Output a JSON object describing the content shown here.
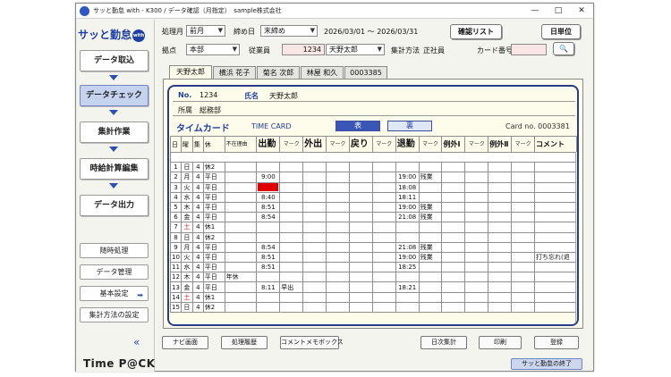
{
  "window": {
    "title": "サッと勤怠 with - K300 / データ確認（月指定）　sample株式会社",
    "controls": [
      "—",
      "□",
      "✕"
    ]
  },
  "sidebar": {
    "logo": "サッと勤怠",
    "logo_badge": "with",
    "steps": [
      "データ取込",
      "データチェック",
      "集計作業",
      "時給計算編集",
      "データ出力"
    ],
    "active_step": "データチェック",
    "buttons": [
      "随時処理",
      "データ管理",
      "基本設定",
      "集計方法の設定"
    ],
    "collapse": "«",
    "brand": "Time P@CK"
  },
  "header": {
    "period_type_label": "処理月",
    "period_type_value": "前月",
    "closing_label": "締め日",
    "closing_value": "末締め",
    "date_range": "2026/03/01 〜 2026/03/31",
    "confirm_list_btn": "確認リスト",
    "daily_btn": "日単位",
    "site_label": "拠点",
    "site_value": "本部",
    "employee_label": "従業員",
    "employee_code": "1234",
    "employee_name": "天野太郎",
    "calc_method_label": "集計方法",
    "calc_method_value": "正社員",
    "card_no_label": "カード番号",
    "card_no_value": "",
    "search_icon": "search-icon"
  },
  "tabs": [
    "天野太郎",
    "横浜 花子",
    "菊名 次郎",
    "林屋 和久",
    "0003385"
  ],
  "active_tab": "天野太郎",
  "employee_info": {
    "no_label": "No.",
    "no_value": "1234",
    "name_label": "氏名",
    "name_value": "天野太郎",
    "dept_label": "所属",
    "dept_value": "総務部"
  },
  "card": {
    "title": "タイムカード",
    "title_en": "TIME CARD",
    "front": "表",
    "back": "裏",
    "card_no": "Card no. 0003381"
  },
  "table": {
    "headers": {
      "day": "日",
      "dow": "曜",
      "agg": "集",
      "rest": "休",
      "absence": "不在理由",
      "in": "出勤",
      "mark": "マーク",
      "out": "外出",
      "back": "戻り",
      "leave": "退勤",
      "ex1": "例外Ⅰ",
      "ex2": "例外Ⅱ",
      "comment": "コメント"
    },
    "rows": [
      {
        "day": "1",
        "dow": "日",
        "agg": "4",
        "rest": "休2",
        "absence": "",
        "in": "",
        "in_mark": "",
        "leave": "",
        "leave_mark": "",
        "comment": ""
      },
      {
        "day": "2",
        "dow": "月",
        "agg": "4",
        "rest": "平日",
        "absence": "",
        "in": "9:00",
        "in_mark": "",
        "leave": "19:00",
        "leave_mark": "残業",
        "comment": ""
      },
      {
        "day": "3",
        "dow": "火",
        "agg": "4",
        "rest": "平日",
        "absence": "",
        "in": "",
        "in_mark": "",
        "leave": "18:08",
        "leave_mark": "",
        "comment": "",
        "missing_in": true
      },
      {
        "day": "4",
        "dow": "水",
        "agg": "4",
        "rest": "平日",
        "absence": "",
        "in": "8:40",
        "in_mark": "",
        "leave": "18:11",
        "leave_mark": "",
        "comment": ""
      },
      {
        "day": "5",
        "dow": "木",
        "agg": "4",
        "rest": "平日",
        "absence": "",
        "in": "8:51",
        "in_mark": "",
        "leave": "19:00",
        "leave_mark": "残業",
        "comment": ""
      },
      {
        "day": "6",
        "dow": "金",
        "agg": "4",
        "rest": "平日",
        "absence": "",
        "in": "8:54",
        "in_mark": "",
        "leave": "21:08",
        "leave_mark": "残業",
        "comment": ""
      },
      {
        "day": "7",
        "dow": "土",
        "agg": "4",
        "rest": "休1",
        "absence": "",
        "in": "",
        "in_mark": "",
        "leave": "",
        "leave_mark": "",
        "comment": "",
        "red_dow": true
      },
      {
        "day": "8",
        "dow": "日",
        "agg": "4",
        "rest": "休2",
        "absence": "",
        "in": "",
        "in_mark": "",
        "leave": "",
        "leave_mark": "",
        "comment": ""
      },
      {
        "day": "9",
        "dow": "月",
        "agg": "4",
        "rest": "平日",
        "absence": "",
        "in": "8:54",
        "in_mark": "",
        "leave": "21:08",
        "leave_mark": "残業",
        "comment": ""
      },
      {
        "day": "10",
        "dow": "火",
        "agg": "4",
        "rest": "平日",
        "absence": "",
        "in": "8:51",
        "in_mark": "",
        "leave": "19:00",
        "leave_mark": "残業",
        "comment": "打ち忘れ(退"
      },
      {
        "day": "11",
        "dow": "水",
        "agg": "4",
        "rest": "平日",
        "absence": "",
        "in": "8:51",
        "in_mark": "",
        "leave": "18:25",
        "leave_mark": "",
        "comment": ""
      },
      {
        "day": "12",
        "dow": "木",
        "agg": "4",
        "rest": "平日",
        "absence": "年休",
        "in": "",
        "in_mark": "",
        "leave": "",
        "leave_mark": "",
        "comment": ""
      },
      {
        "day": "13",
        "dow": "金",
        "agg": "4",
        "rest": "平日",
        "absence": "",
        "in": "8:11",
        "in_mark": "早出",
        "leave": "18:21",
        "leave_mark": "",
        "comment": ""
      },
      {
        "day": "14",
        "dow": "土",
        "agg": "4",
        "rest": "休1",
        "absence": "",
        "in": "",
        "in_mark": "",
        "leave": "",
        "leave_mark": "",
        "comment": "",
        "red_dow": true
      },
      {
        "day": "15",
        "dow": "日",
        "agg": "4",
        "rest": "休2",
        "absence": "",
        "in": "",
        "in_mark": "",
        "leave": "",
        "leave_mark": "",
        "comment": ""
      }
    ]
  },
  "bottom_buttons": [
    "ナビ画面",
    "処理履歴",
    "コメントメモボックス",
    "日次集計",
    "印刷",
    "登録"
  ],
  "exit_button": "サッと勤怠の終了",
  "colors": {
    "accent": "#1f3fa8",
    "active_step": "#c5d3ee",
    "panel_bg": "#fdfbe9",
    "missing": "#e00000"
  }
}
